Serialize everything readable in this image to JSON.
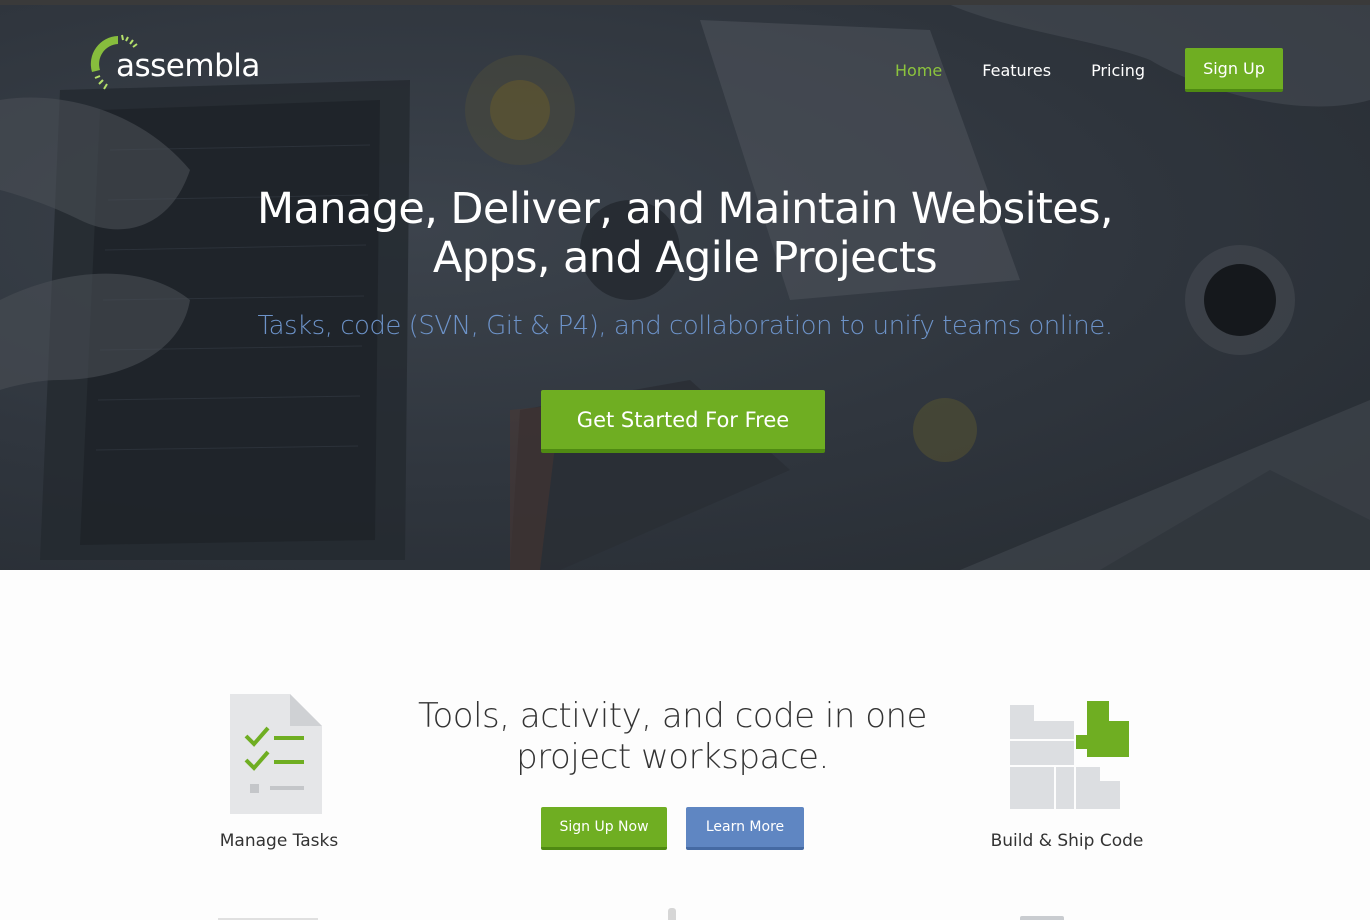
{
  "header": {
    "logo_text": "assembla",
    "nav": [
      {
        "label": "Home",
        "active": true
      },
      {
        "label": "Features",
        "active": false
      },
      {
        "label": "Pricing",
        "active": false
      }
    ],
    "signup_label": "Sign Up"
  },
  "hero": {
    "headline_line1": "Manage, Deliver, and Maintain Websites,",
    "headline_line2": "Apps, and Agile Projects",
    "subheadline": "Tasks, code (SVN, Git & P4), and collaboration to unify teams online.",
    "cta_label": "Get Started For Free"
  },
  "features": {
    "left_label": "Manage Tasks",
    "right_label": "Build & Ship Code",
    "center_title_line1": "Tools, activity, and code in one",
    "center_title_line2": "project workspace.",
    "signup_now_label": "Sign Up Now",
    "learn_more_label": "Learn More"
  },
  "colors": {
    "accent_green": "#6fae22",
    "active_nav": "#8cc43d",
    "subhead_blue": "#6d93c9",
    "button_blue": "#5f86c2",
    "hero_dark": "#2f353d"
  },
  "icons": [
    "assembla-logo-icon",
    "checklist-document-icon",
    "blocks-build-icon"
  ]
}
